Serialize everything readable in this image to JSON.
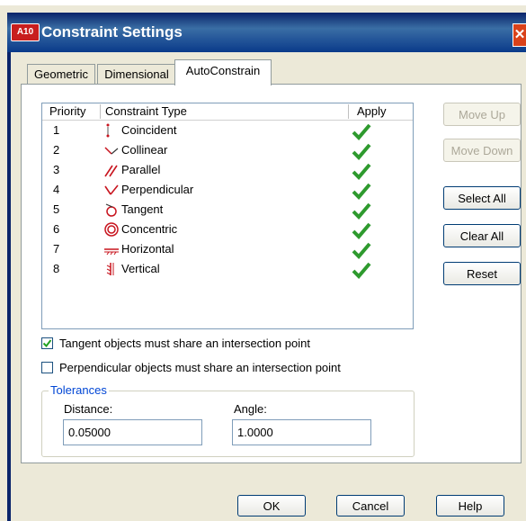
{
  "window": {
    "title": "Constraint Settings",
    "app_icon_label": "A10",
    "close_glyph": "✕"
  },
  "tabs": [
    {
      "label": "Geometric",
      "active": false
    },
    {
      "label": "Dimensional",
      "active": false
    },
    {
      "label": "AutoConstrain",
      "active": true
    }
  ],
  "table": {
    "columns": [
      "Priority",
      "Constraint Type",
      "Apply"
    ],
    "rows": [
      {
        "priority": "1",
        "type": "Coincident",
        "icon": "coincident-icon",
        "apply": true
      },
      {
        "priority": "2",
        "type": "Collinear",
        "icon": "collinear-icon",
        "apply": true
      },
      {
        "priority": "3",
        "type": "Parallel",
        "icon": "parallel-icon",
        "apply": true
      },
      {
        "priority": "4",
        "type": "Perpendicular",
        "icon": "perpendicular-icon",
        "apply": true
      },
      {
        "priority": "5",
        "type": "Tangent",
        "icon": "tangent-icon",
        "apply": true
      },
      {
        "priority": "6",
        "type": "Concentric",
        "icon": "concentric-icon",
        "apply": true
      },
      {
        "priority": "7",
        "type": "Horizontal",
        "icon": "horizontal-icon",
        "apply": true
      },
      {
        "priority": "8",
        "type": "Vertical",
        "icon": "vertical-icon",
        "apply": true
      }
    ]
  },
  "side_buttons": {
    "move_up": "Move Up",
    "move_down": "Move Down",
    "select_all": "Select All",
    "clear_all": "Clear All",
    "reset": "Reset"
  },
  "options": {
    "tangent": {
      "label": "Tangent objects must share an intersection point",
      "checked": true
    },
    "perpendicular": {
      "label": "Perpendicular objects must share an intersection point",
      "checked": false
    }
  },
  "tolerances": {
    "title": "Tolerances",
    "distance_label": "Distance:",
    "distance_value": "0.05000",
    "angle_label": "Angle:",
    "angle_value": "1.0000"
  },
  "footer": {
    "ok": "OK",
    "cancel": "Cancel",
    "help": "Help"
  },
  "colors": {
    "titlebar": "#0a246a",
    "apply_check": "#2e9a2e",
    "constraint_icon": "#c8141e",
    "group_title": "#0046d5"
  }
}
